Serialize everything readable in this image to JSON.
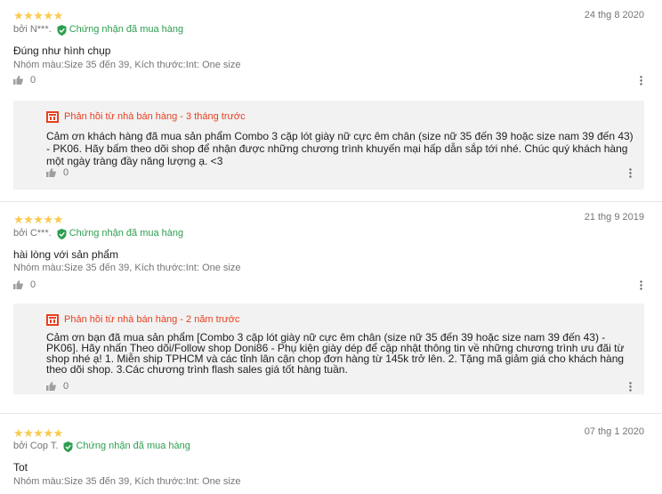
{
  "colors": {
    "star": "#faca51",
    "verified": "#2e9e4f",
    "reply_title": "#e7401e",
    "reply_bg": "#f2f2f2"
  },
  "reviews": [
    {
      "stars": "★★★★★",
      "author": "bởi N***.",
      "verified": "Chứng nhận đã mua hàng",
      "date": "24 thg 8 2020",
      "content": "Đúng như hình chụp",
      "variant": "Nhóm màu:Size 35 đến 39, Kích thước:Int: One size",
      "likes": "0",
      "reply": {
        "title": "Phản hồi từ nhà bán hàng - 3 tháng trước",
        "text": "Cảm ơn khách hàng đã mua sản phẩm Combo 3 cặp lót giày nữ cực êm chân (size nữ 35 đến 39 hoặc size nam 39 đến 43) - PK06. Hãy bấm theo dõi shop để nhận được những chương trình khuyến mại hấp dẫn sắp tới nhé. Chúc quý khách hàng một ngày tràng đầy năng lượng ạ. <3",
        "likes": "0"
      }
    },
    {
      "stars": "★★★★★",
      "author": "bởi C***.",
      "verified": "Chứng nhận đã mua hàng",
      "date": "21 thg 9 2019",
      "content": "hài lòng với sản phẩm",
      "variant": "Nhóm màu:Size 35 đến 39, Kích thước:Int: One size",
      "likes": "0",
      "reply": {
        "title": "Phản hồi từ nhà bán hàng - 2 năm trước",
        "text": "Cảm ơn bạn đã mua sản phẩm [Combo 3 cặp lót giày nữ cực êm chân (size nữ 35 đến 39 hoặc size nam 39 đến 43) - PK06]. Hãy nhấn Theo dõi/Follow shop Doni86 - Phụ kiện giày dép để cập nhật thông tin về những chương trình ưu đãi từ shop nhé ạ! 1. Miễn ship TPHCM và các tỉnh lân cận chop đơn hàng từ 145k trở lên. 2. Tặng mã giảm giá cho khách hàng theo dõi shop. 3.Các chương trình flash sales giá tốt hàng tuần.",
        "likes": "0"
      }
    },
    {
      "stars": "★★★★★",
      "author": "bởi Cop T.",
      "verified": "Chứng nhận đã mua hàng",
      "date": "07 thg 1 2020",
      "content": "Tot",
      "variant": "Nhóm màu:Size 35 đến 39, Kích thước:Int: One size"
    }
  ]
}
